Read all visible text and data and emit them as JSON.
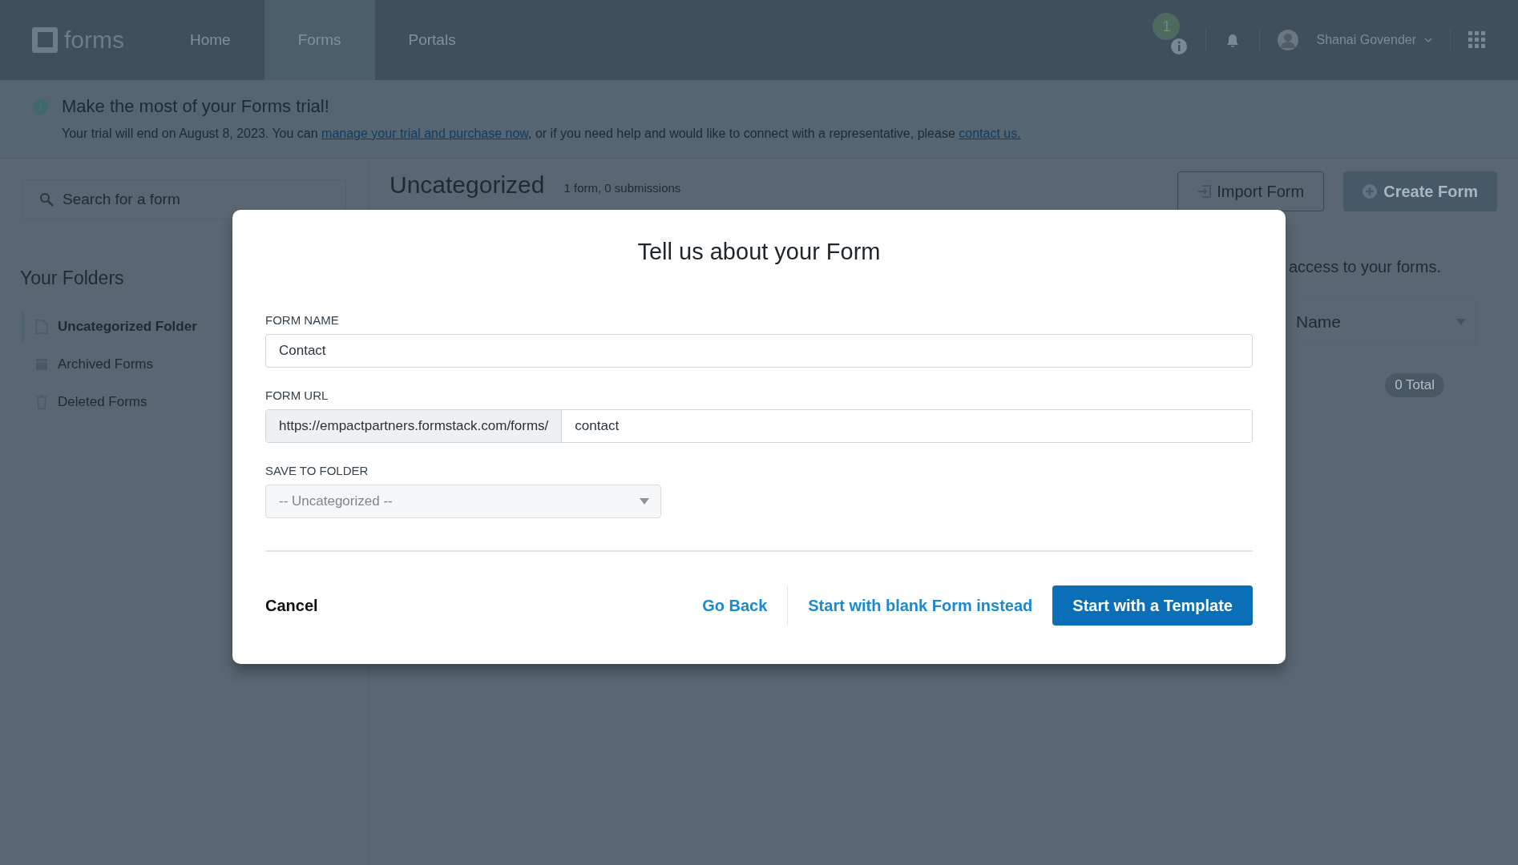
{
  "header": {
    "logo": "forms",
    "nav": [
      {
        "label": "Home",
        "selected": false
      },
      {
        "label": "Forms",
        "selected": true
      },
      {
        "label": "Portals",
        "selected": false
      }
    ],
    "notification_count": "1",
    "user": "Shanai Govender"
  },
  "banner": {
    "title": "Make the most of your Forms trial!",
    "text_before": "Your trial will end on August 8, 2023. You can ",
    "link_1": "manage your trial and purchase now",
    "text_middle": ", or if you need help and would like to connect with a representative, please ",
    "link_2": "contact us."
  },
  "sidebar": {
    "search": {
      "placeholder": "Search for a form"
    },
    "heading": "Your Folders",
    "folders": [
      {
        "label": "Uncategorized Folder",
        "kind": "folder",
        "selected": true
      },
      {
        "label": "Archived Forms",
        "kind": "archive",
        "selected": false
      },
      {
        "label": "Deleted Forms",
        "kind": "trash",
        "selected": false
      }
    ]
  },
  "main": {
    "title": "Uncategorized",
    "subtitle": "1 form, 0 submissions",
    "import_button": "Import Form",
    "create_button": "Create Form",
    "access_text": "access to your forms.",
    "sort_select": "Name",
    "total_badge": "0 Total"
  },
  "modal": {
    "title": "Tell us about your Form",
    "fields": [
      {
        "label": "FORM NAME",
        "value": "Contact"
      },
      {
        "label": "FORM URL",
        "prefix": "https://empactpartners.formstack.com/forms/",
        "value": "contact"
      }
    ],
    "folder": {
      "label": "SAVE TO FOLDER",
      "value": "-- Uncategorized --",
      "disabled": true
    },
    "cancel": "Cancel",
    "go_back": "Go Back",
    "blank": "Start with blank Form instead",
    "template": "Start with a Template"
  }
}
